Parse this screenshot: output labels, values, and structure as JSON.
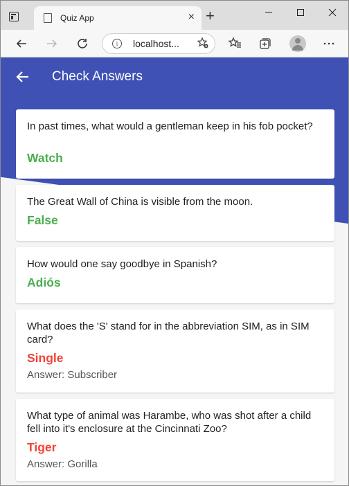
{
  "browser": {
    "tab_title": "Quiz App",
    "tab_close": "×",
    "new_tab": "+",
    "address": "localhost..."
  },
  "app": {
    "title": "Check Answers",
    "colors": {
      "primary": "#3f51b5",
      "correct": "#4caf50",
      "wrong": "#f44336"
    }
  },
  "questions": [
    {
      "question": "In past times, what would a gentleman keep in his fob pocket?",
      "given": "Watch",
      "is_correct": true
    },
    {
      "question": "The Great Wall of China is visible from the moon.",
      "given": "False",
      "is_correct": true
    },
    {
      "question": "How would one say goodbye in Spanish?",
      "given": "Adiós",
      "is_correct": true
    },
    {
      "question": "What does the 'S' stand for in the abbreviation SIM, as in SIM card?",
      "given": "Single",
      "is_correct": false,
      "correct_label": "Answer: Subscriber"
    },
    {
      "question": "What type of animal was Harambe, who was shot after a child fell into it's enclosure at the Cincinnati Zoo?",
      "given": "Tiger",
      "is_correct": false,
      "correct_label": "Answer: Gorilla"
    }
  ]
}
